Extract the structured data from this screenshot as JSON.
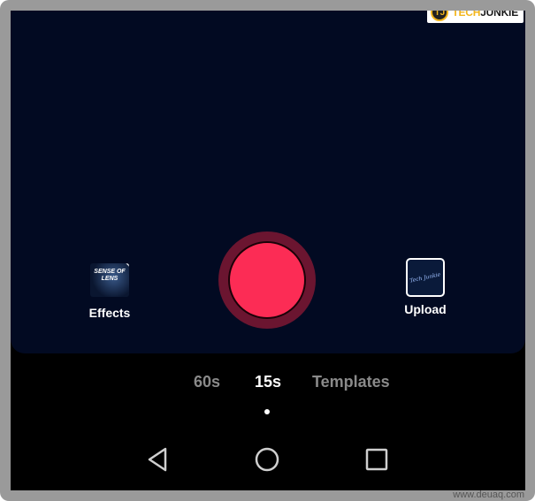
{
  "watermark": {
    "logo": "TJ",
    "tech": "TECH",
    "junkie": "JUNKIE"
  },
  "effects": {
    "label": "Effects",
    "thumb_text": "SENSE OF LENS",
    "icon": "effects-thumbnail"
  },
  "upload": {
    "label": "Upload",
    "thumb_text": "Tech Junkie",
    "icon": "upload-thumbnail"
  },
  "record": {
    "icon": "record-button",
    "color": "#fc2c55"
  },
  "tabs": [
    {
      "label": "60s",
      "active": false
    },
    {
      "label": "15s",
      "active": true
    },
    {
      "label": "Templates",
      "active": false
    }
  ],
  "navbar": {
    "back": "back-triangle-icon",
    "home": "home-circle-icon",
    "recents": "recents-square-icon"
  },
  "footer_watermark": "www.deuaq.com",
  "colors": {
    "camera_bg": "#020a22",
    "record_ring": "#6b1530",
    "record_fill": "#fc2c55",
    "inactive_tab": "#8a8a8a"
  }
}
